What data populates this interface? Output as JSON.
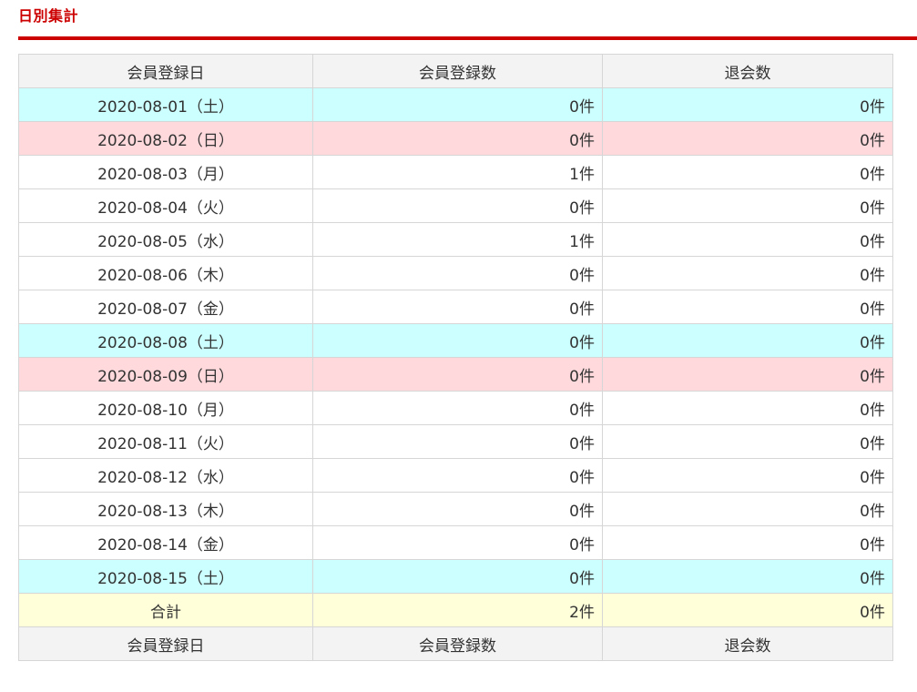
{
  "section": {
    "title": "日別集計"
  },
  "table": {
    "headers": [
      "会員登録日",
      "会員登録数",
      "退会数"
    ],
    "rows": [
      {
        "date": "2020-08-01（土）",
        "registrations": "0件",
        "withdrawals": "0件",
        "day_type": "sat"
      },
      {
        "date": "2020-08-02（日）",
        "registrations": "0件",
        "withdrawals": "0件",
        "day_type": "sun"
      },
      {
        "date": "2020-08-03（月）",
        "registrations": "1件",
        "withdrawals": "0件",
        "day_type": "weekday"
      },
      {
        "date": "2020-08-04（火）",
        "registrations": "0件",
        "withdrawals": "0件",
        "day_type": "weekday"
      },
      {
        "date": "2020-08-05（水）",
        "registrations": "1件",
        "withdrawals": "0件",
        "day_type": "weekday"
      },
      {
        "date": "2020-08-06（木）",
        "registrations": "0件",
        "withdrawals": "0件",
        "day_type": "weekday"
      },
      {
        "date": "2020-08-07（金）",
        "registrations": "0件",
        "withdrawals": "0件",
        "day_type": "weekday"
      },
      {
        "date": "2020-08-08（土）",
        "registrations": "0件",
        "withdrawals": "0件",
        "day_type": "sat"
      },
      {
        "date": "2020-08-09（日）",
        "registrations": "0件",
        "withdrawals": "0件",
        "day_type": "sun"
      },
      {
        "date": "2020-08-10（月）",
        "registrations": "0件",
        "withdrawals": "0件",
        "day_type": "weekday"
      },
      {
        "date": "2020-08-11（火）",
        "registrations": "0件",
        "withdrawals": "0件",
        "day_type": "weekday"
      },
      {
        "date": "2020-08-12（水）",
        "registrations": "0件",
        "withdrawals": "0件",
        "day_type": "weekday"
      },
      {
        "date": "2020-08-13（木）",
        "registrations": "0件",
        "withdrawals": "0件",
        "day_type": "weekday"
      },
      {
        "date": "2020-08-14（金）",
        "registrations": "0件",
        "withdrawals": "0件",
        "day_type": "weekday"
      },
      {
        "date": "2020-08-15（土）",
        "registrations": "0件",
        "withdrawals": "0件",
        "day_type": "sat"
      }
    ],
    "total": {
      "label": "合計",
      "registrations": "2件",
      "withdrawals": "0件"
    },
    "footer_headers": [
      "会員登録日",
      "会員登録数",
      "退会数"
    ]
  },
  "colors": {
    "accent": "#cc0000",
    "saturday_row": "#ccffff",
    "sunday_row": "#ffd9dc",
    "total_row": "#ffffd9",
    "header_bg": "#f3f3f3"
  }
}
